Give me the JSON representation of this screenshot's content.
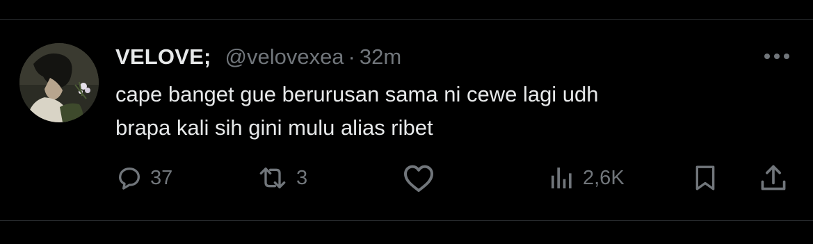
{
  "tweet": {
    "display_name": "VELOVE;",
    "handle": "@velovexea",
    "separator": "·",
    "time": "32m",
    "text": "cape banget gue berurusan sama ni cewe lagi udh\nbrapa kali sih gini mulu alias ribet",
    "avatar_icon": "profile-photo-avatar",
    "more_icon": "more-horizontal-icon"
  },
  "actions": {
    "replies": {
      "icon": "reply-icon",
      "count": "37"
    },
    "reposts": {
      "icon": "repost-icon",
      "count": "3"
    },
    "likes": {
      "icon": "heart-icon",
      "count": ""
    },
    "views": {
      "icon": "views-bar-chart-icon",
      "count": "2,6K"
    },
    "bookmark": {
      "icon": "bookmark-icon"
    },
    "share": {
      "icon": "share-upload-icon"
    }
  },
  "colors": {
    "background": "#000000",
    "text_primary": "#e7e9ea",
    "text_secondary": "#71767b",
    "divider": "#2f3336"
  }
}
